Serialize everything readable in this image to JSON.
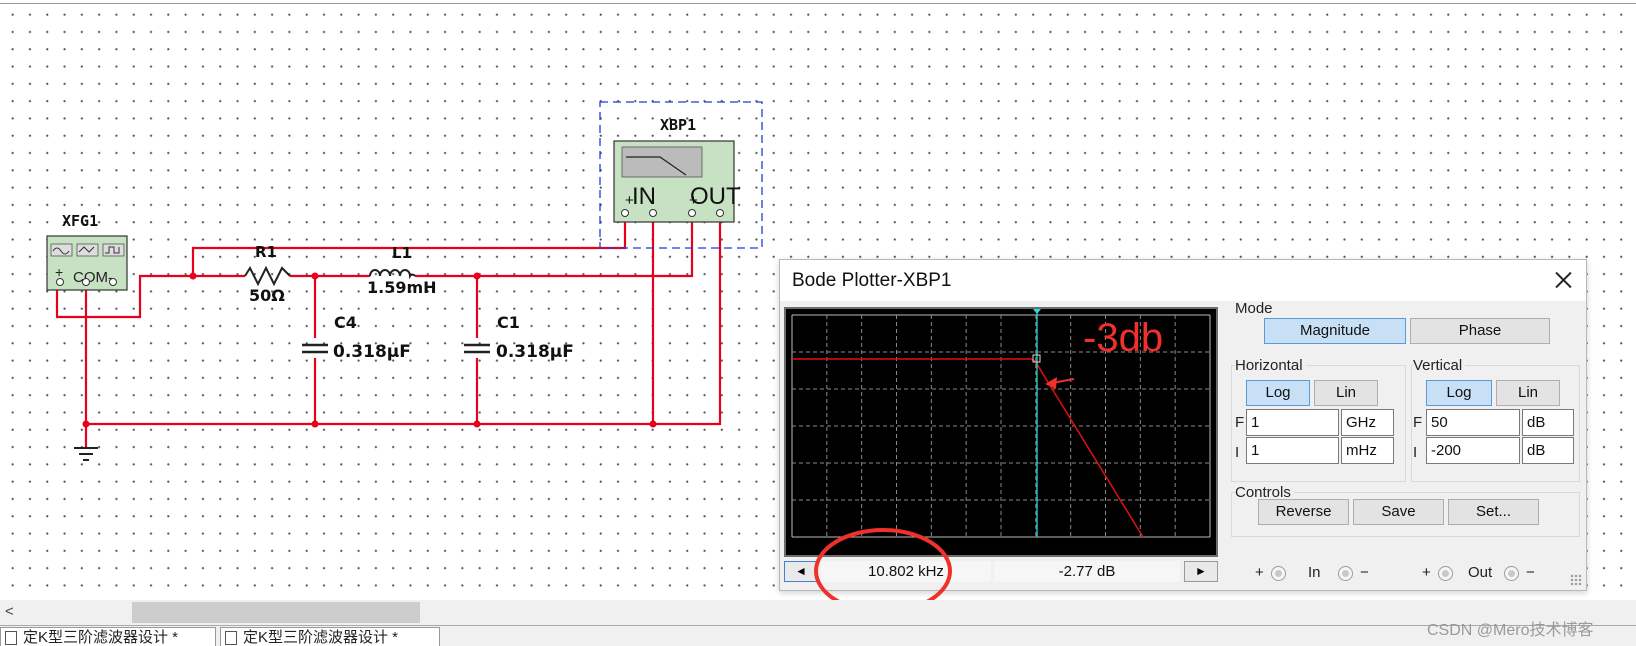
{
  "schematic": {
    "function_generator": {
      "ref": "XFG1",
      "terminals": [
        "+",
        "COM",
        "-"
      ]
    },
    "bode_instrument": {
      "ref": "XBP1",
      "in_label": "IN",
      "out_label": "OUT"
    },
    "components": {
      "r1": {
        "ref": "R1",
        "value": "50Ω"
      },
      "l1": {
        "ref": "L1",
        "value": "1.59mH"
      },
      "c4": {
        "ref": "C4",
        "value": "0.318μF"
      },
      "c1": {
        "ref": "C1",
        "value": "0.318μF"
      }
    }
  },
  "annotation": {
    "text": "-3db",
    "color": "#f0302a"
  },
  "bode_window": {
    "title": "Bode Plotter-XBP1",
    "mode": {
      "label": "Mode",
      "magnitude": "Magnitude",
      "phase": "Phase",
      "selected": "Magnitude"
    },
    "horizontal": {
      "label": "Horizontal",
      "log": "Log",
      "lin": "Lin",
      "selected": "Log",
      "f_label": "F",
      "f_value": "1",
      "f_unit": "GHz",
      "i_label": "I",
      "i_value": "1",
      "i_unit": "mHz"
    },
    "vertical": {
      "label": "Vertical",
      "log": "Log",
      "lin": "Lin",
      "selected": "Log",
      "f_label": "F",
      "f_value": "50",
      "f_unit": "dB",
      "i_label": "I",
      "i_value": "-200",
      "i_unit": "dB"
    },
    "controls": {
      "label": "Controls",
      "reverse": "Reverse",
      "save": "Save",
      "set": "Set..."
    },
    "readout": {
      "frequency": "10.802 kHz",
      "magnitude": "-2.77 dB"
    },
    "terminals": {
      "in_label": "In",
      "out_label": "Out",
      "plus": "+",
      "minus": "−"
    },
    "colors": {
      "trace": "#e01010",
      "cursor": "#2fd6d6",
      "grid": "#8a8a8a",
      "highlight": "#e8151b"
    }
  },
  "tabs": [
    "定K型三阶滤波器设计 *",
    "定K型三阶滤波器设计 *"
  ],
  "watermark": "CSDN @Mero技术博客"
}
